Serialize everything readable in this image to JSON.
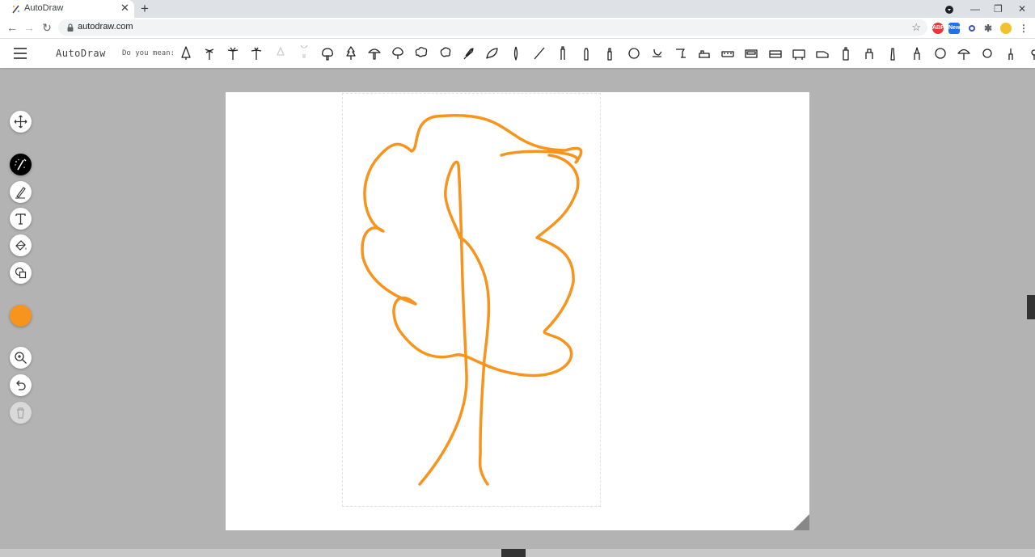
{
  "browser": {
    "tab_title": "AutoDraw",
    "url": "autodraw.com",
    "close_glyph": "✕",
    "new_tab_glyph": "+",
    "window_controls": {
      "minimize": "—",
      "restore": "❐",
      "close": "✕"
    },
    "extensions": [
      {
        "name": "abp",
        "label": "ABP",
        "color": "#e53935"
      },
      {
        "name": "new",
        "label": "New",
        "color": "#1e73e8"
      },
      {
        "name": "ext-blue",
        "label": "",
        "color": "#3f51b5"
      },
      {
        "name": "puzzle",
        "label": "",
        "color": "#5f6368"
      },
      {
        "name": "profile",
        "label": "",
        "color": "#f2c12e"
      }
    ]
  },
  "app": {
    "title": "AutoDraw",
    "suggest_label": "Do you mean:",
    "suggestions": [
      "tree",
      "palm-trees",
      "palm-tree",
      "palm-tree-2",
      "pine-faded",
      "lightbulb-faded",
      "broccoli",
      "pine-tree",
      "mushroom",
      "tree-round",
      "cloud",
      "bush",
      "feather",
      "leaf",
      "feather-2",
      "line",
      "lighthouse",
      "bottle",
      "bottle-2",
      "peach",
      "hook",
      "sprinkler",
      "train",
      "train-2",
      "bus",
      "bus-2",
      "bus-3",
      "truck",
      "fire-hydrant",
      "robot",
      "tower",
      "tower-2",
      "sun",
      "fan",
      "flower",
      "lamp",
      "flower-2",
      "flower-3"
    ]
  },
  "tools": [
    "move",
    "autodraw",
    "draw",
    "type",
    "fill",
    "shape",
    "zoom",
    "undo",
    "delete"
  ],
  "colors": {
    "current": "#f7941d",
    "stroke": "#f7941d"
  }
}
